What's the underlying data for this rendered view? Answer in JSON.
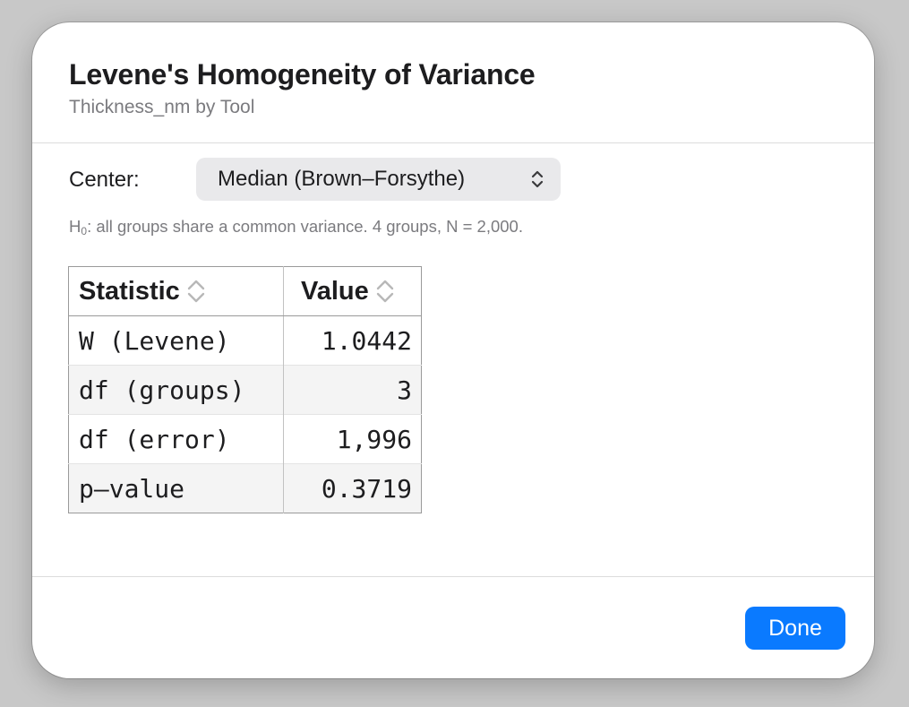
{
  "dialog": {
    "title": "Levene's Homogeneity of Variance",
    "subtitle": "Thickness_nm by Tool"
  },
  "center": {
    "label": "Center:",
    "selected": "Median (Brown–Forsythe)"
  },
  "hint": {
    "h_main": "H",
    "h_sub": "0",
    "text": ": all groups share a common variance. 4 groups, N = 2,000."
  },
  "table": {
    "columns": [
      "Statistic",
      "Value"
    ],
    "rows": [
      {
        "statistic": "W (Levene)",
        "value": "1.0442"
      },
      {
        "statistic": "df (groups)",
        "value": "3"
      },
      {
        "statistic": "df (error)",
        "value": "1,996"
      },
      {
        "statistic": "p–value",
        "value": "0.3719"
      }
    ]
  },
  "footer": {
    "done_label": "Done"
  },
  "colors": {
    "accent": "#0a7aff",
    "table_border": "#9a9a9a",
    "alt_row": "#f4f4f4"
  },
  "icons": {
    "popup": "chevron-up-down-icon",
    "sort": "sort-up-down-icon"
  }
}
